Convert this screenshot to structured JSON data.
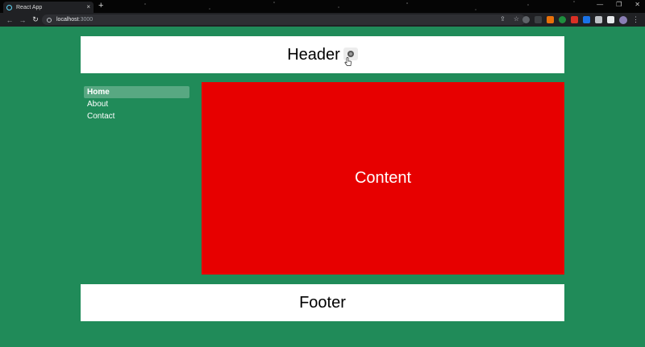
{
  "browser": {
    "tab_title": "React App",
    "tab_close": "×",
    "new_tab": "+",
    "url_host": "localhost",
    "url_port": ":3000"
  },
  "colors": {
    "page_background": "#208b59",
    "content_background": "#e70000",
    "panel_background": "#ffffff"
  },
  "header": {
    "title": "Header"
  },
  "sidebar": {
    "items": [
      {
        "label": "Home",
        "active": true
      },
      {
        "label": "About",
        "active": false
      },
      {
        "label": "Contact",
        "active": false
      }
    ]
  },
  "main": {
    "content_label": "Content"
  },
  "footer": {
    "label": "Footer"
  }
}
